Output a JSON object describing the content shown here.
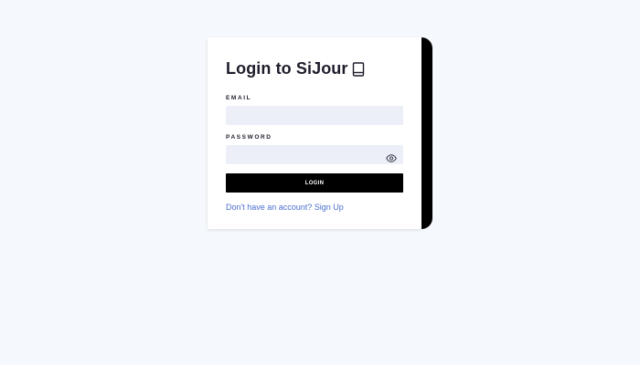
{
  "login": {
    "title": "Login to SiJour",
    "title_icon": "book-icon",
    "email_label": "EMAIL",
    "email_value": "",
    "password_label": "PASSWORD",
    "password_value": "",
    "password_toggle_icon": "eye-icon",
    "submit_label": "LOGIN",
    "signup_prompt": "Don't have an account? Sign Up"
  },
  "colors": {
    "background": "#f5f8fc",
    "card": "#ffffff",
    "card_accent": "#000000",
    "input_bg": "#eceff8",
    "button_bg": "#000000",
    "link": "#4a6fd1",
    "text": "#1f1d2b"
  }
}
